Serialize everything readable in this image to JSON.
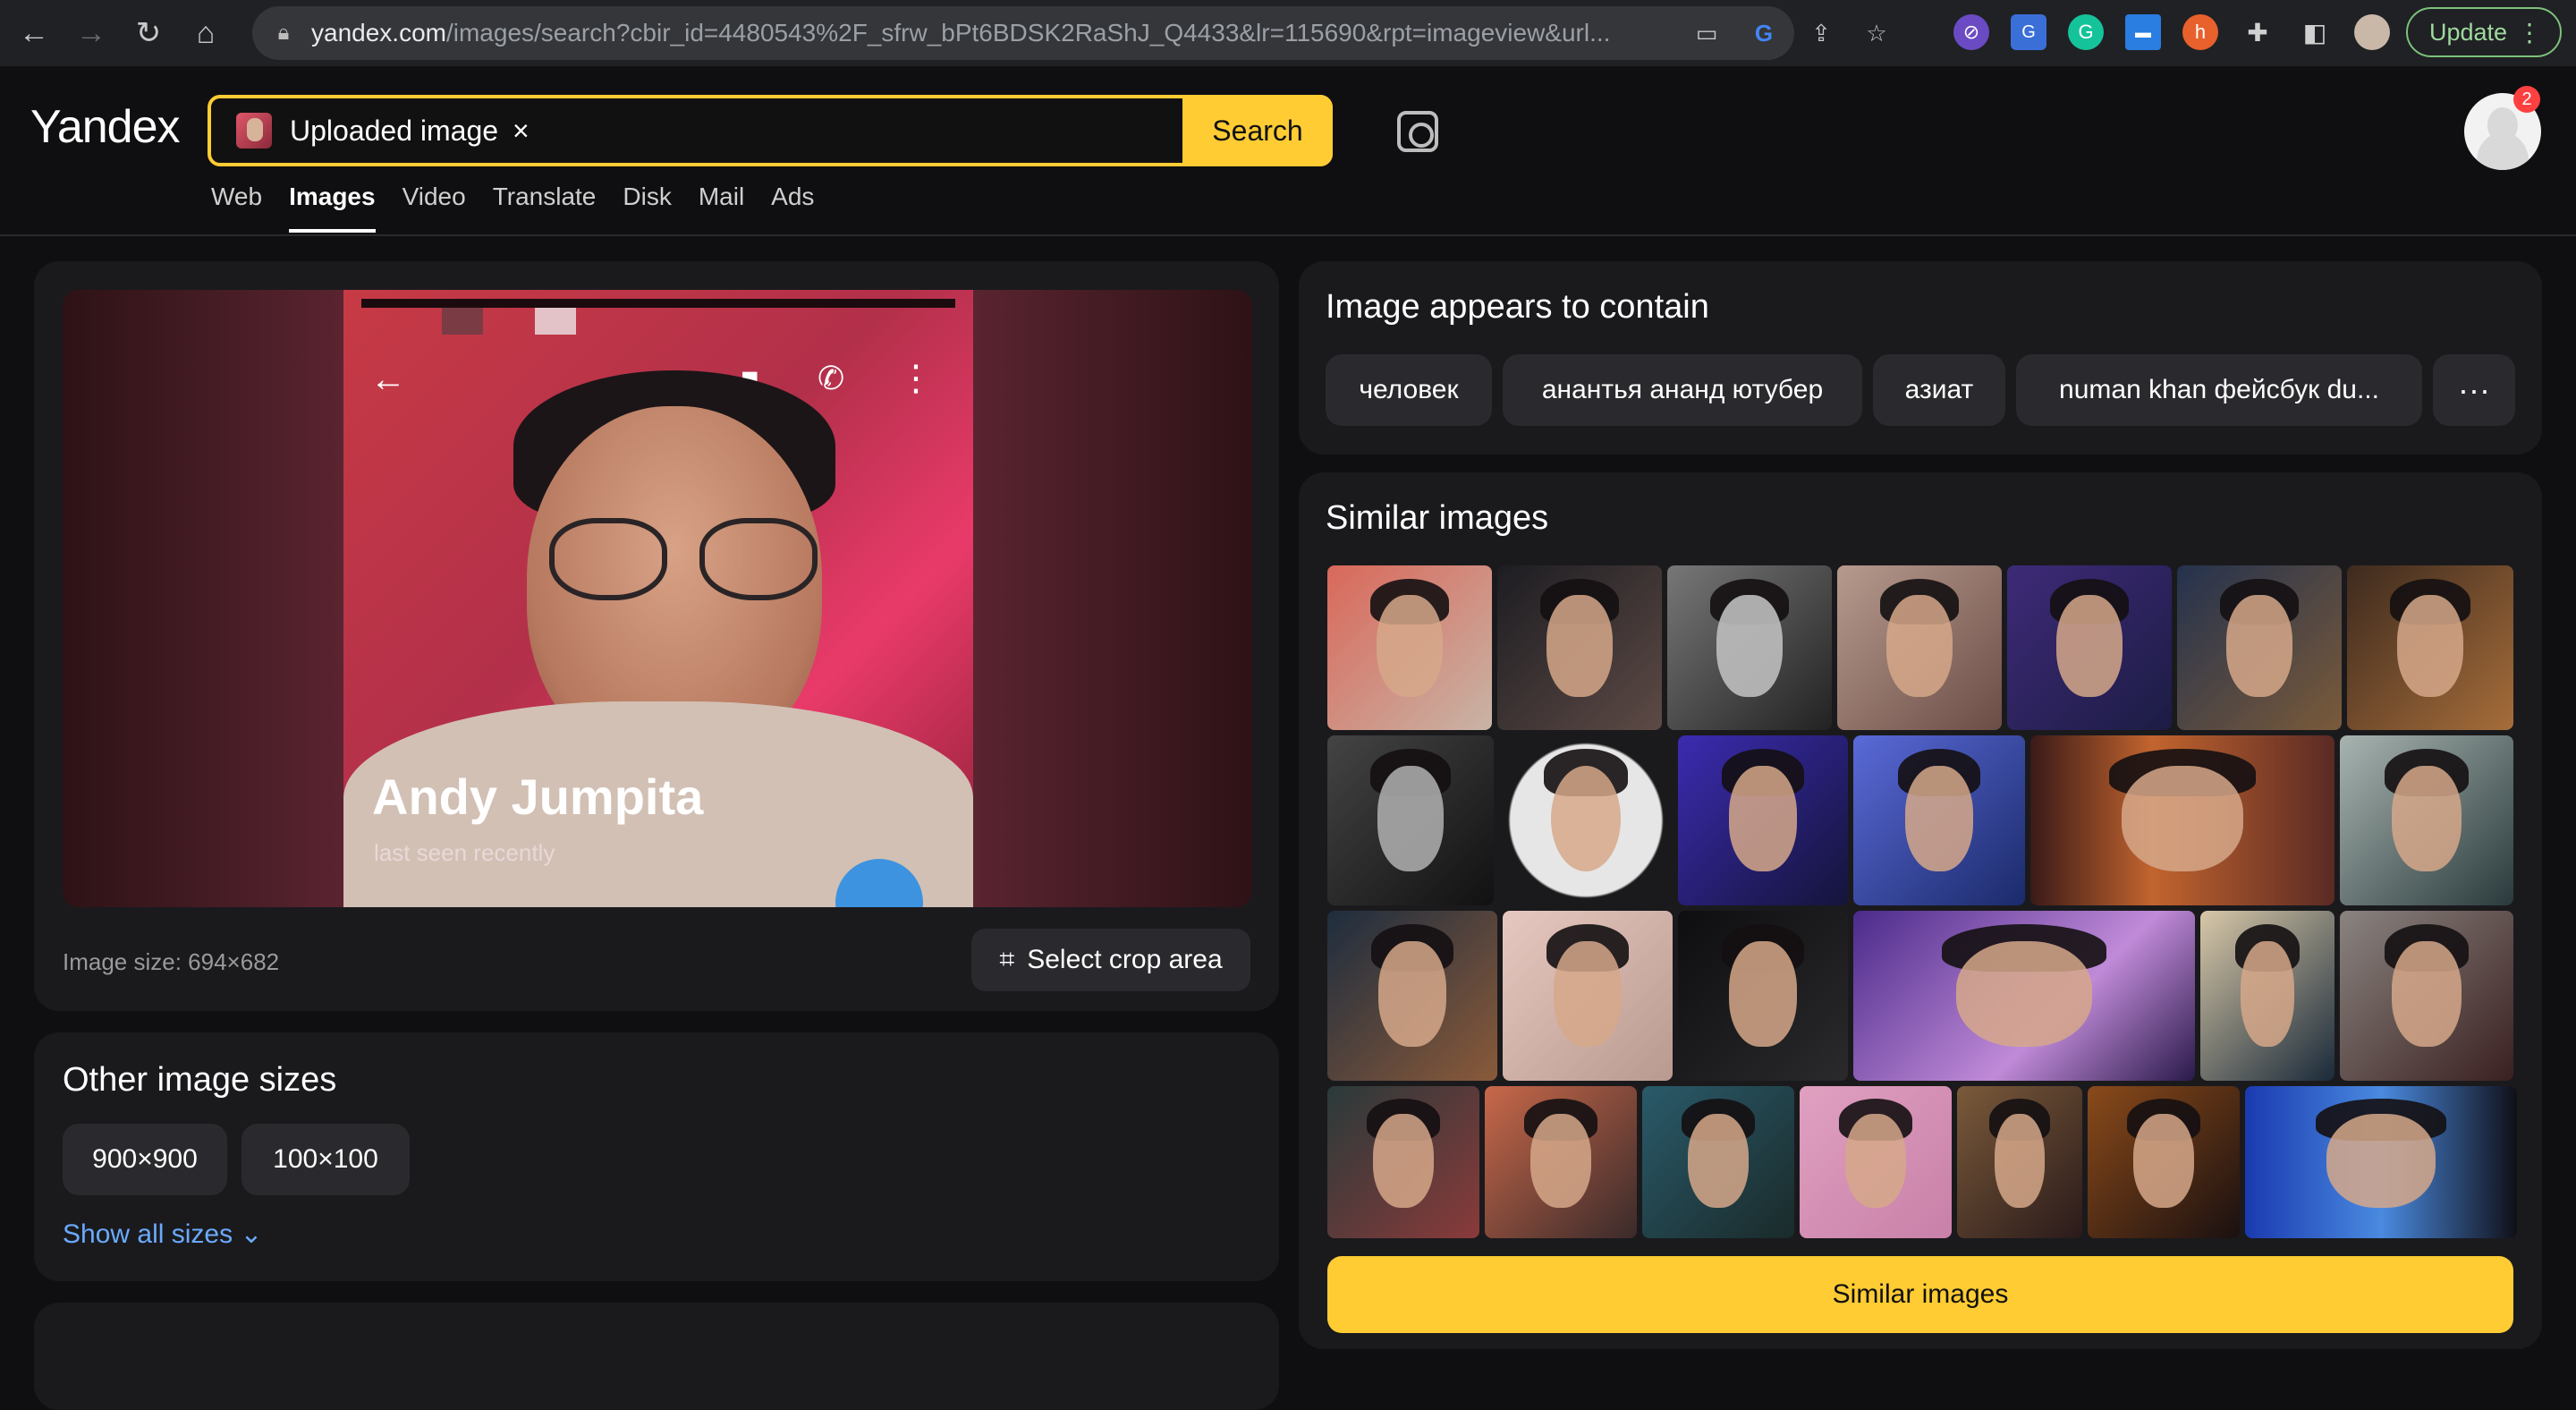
{
  "browser": {
    "url_host": "yandex.com",
    "url_rest": "/images/search?cbir_id=4480543%2F_sfrw_bPt6BDSK2RaShJ_Q4433&lr=115690&rpt=imageview&url...",
    "update_label": "Update"
  },
  "header": {
    "logo": "Yandex",
    "search_chip": "Uploaded image",
    "chip_close": "×",
    "search_button": "Search",
    "notifications": "2",
    "tabs": [
      "Web",
      "Images",
      "Video",
      "Translate",
      "Disk",
      "Mail",
      "Ads"
    ],
    "active_tab": "Images"
  },
  "preview": {
    "contact_name": "Andy Jumpita",
    "contact_status": "last seen recently",
    "image_size": "Image size: 694×682",
    "crop_button": "Select crop area"
  },
  "other_sizes": {
    "title": "Other image sizes",
    "sizes": [
      "900×900",
      "100×100"
    ],
    "show_all": "Show all sizes"
  },
  "contains": {
    "title": "Image appears to contain",
    "tags": [
      "человек",
      "анантья ананд ютубер",
      "азиат",
      "numan khan фейсбук du...",
      "···"
    ]
  },
  "similar": {
    "title": "Similar images",
    "button": "Similar images"
  },
  "colors": {
    "accent": "#ffcc33",
    "link": "#6aaaff"
  }
}
